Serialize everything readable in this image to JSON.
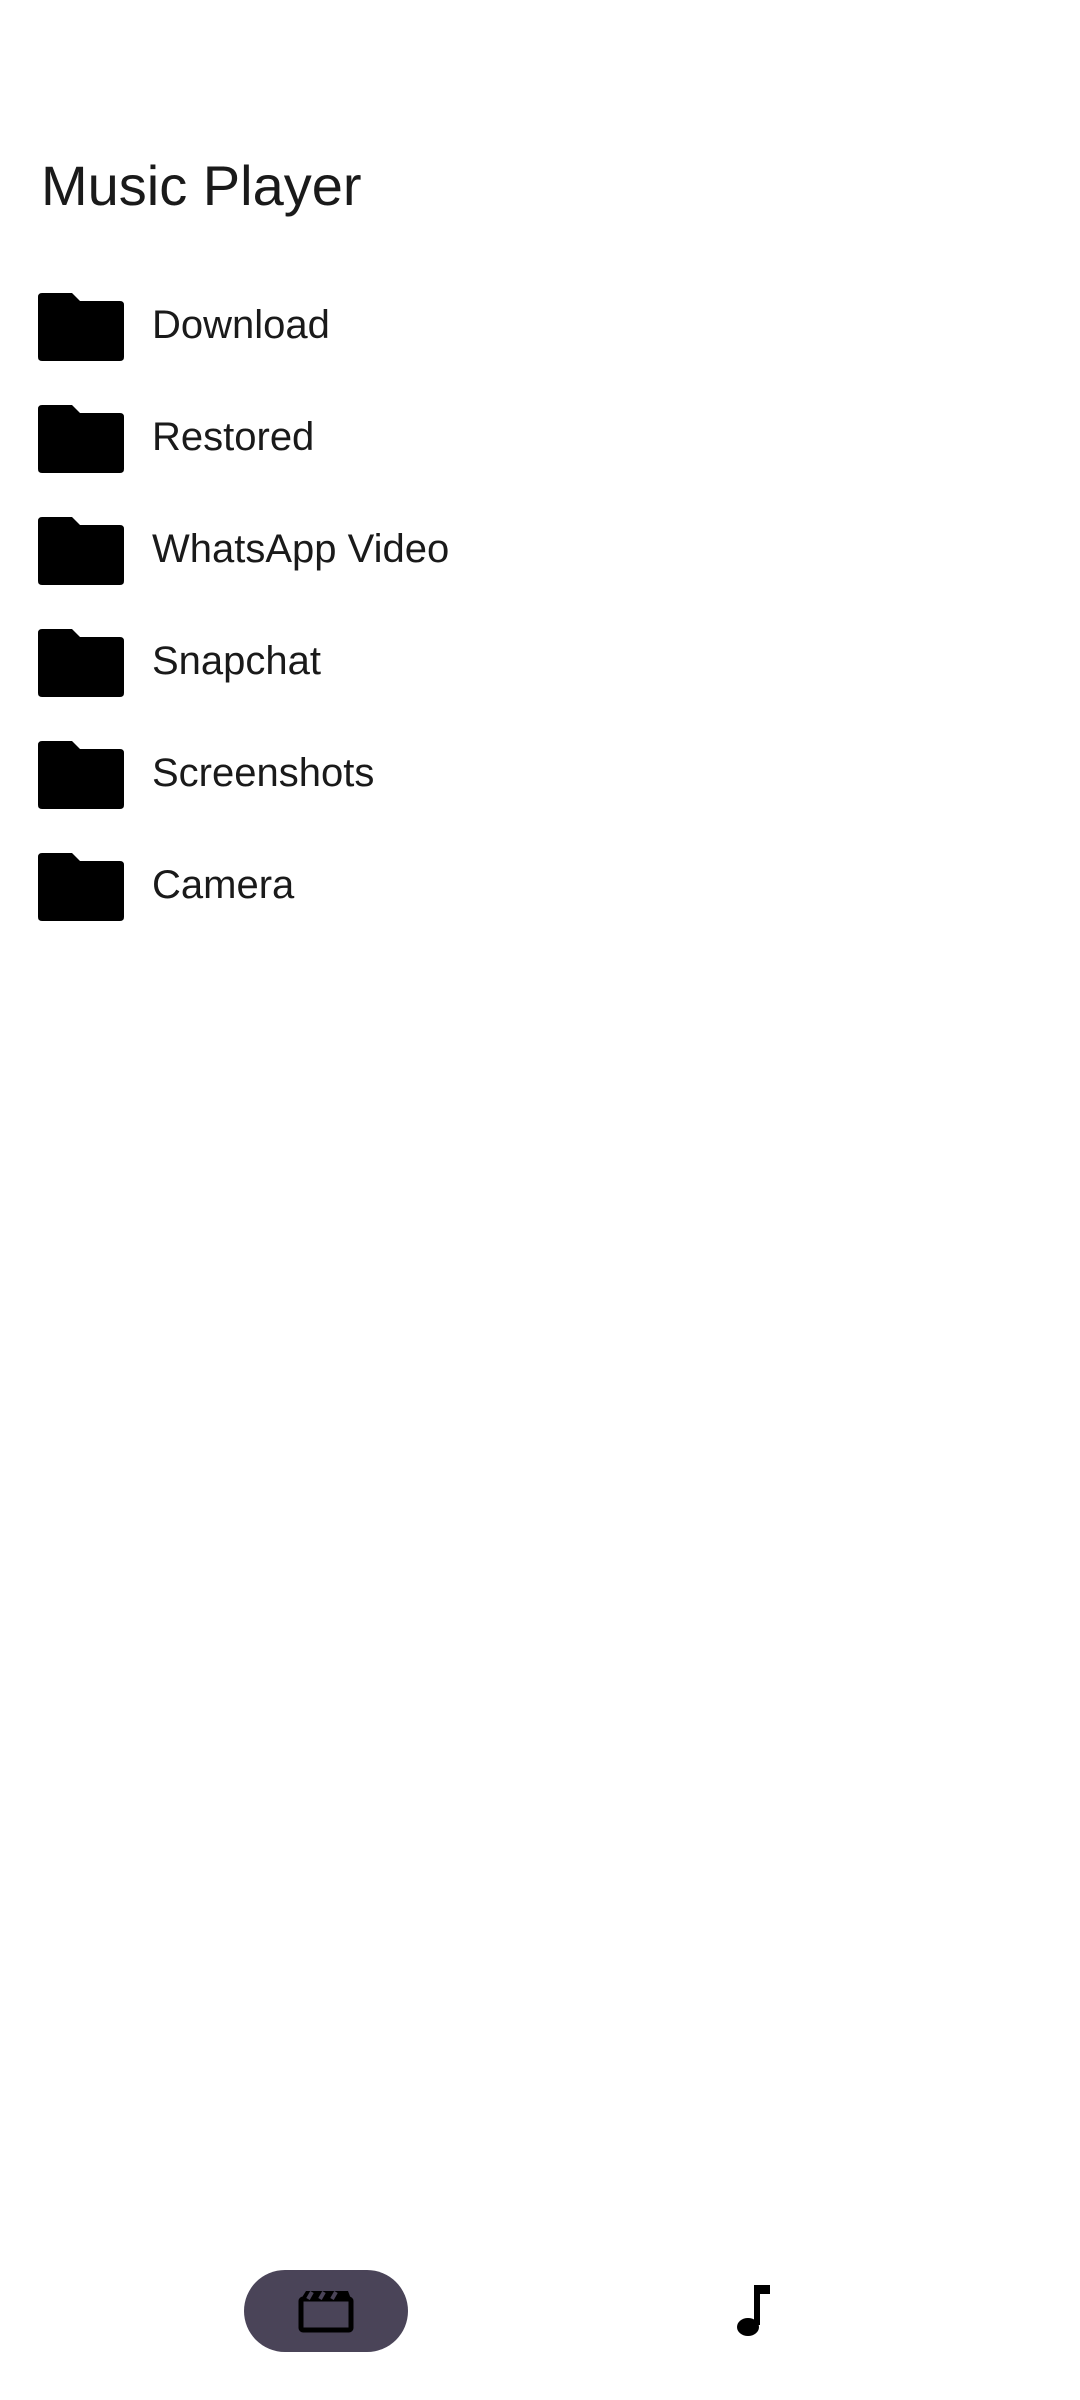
{
  "header": {
    "title": "Music Player"
  },
  "folders": [
    {
      "label": "Download",
      "icon": "folder-icon"
    },
    {
      "label": "Restored",
      "icon": "folder-icon"
    },
    {
      "label": "WhatsApp Video",
      "icon": "folder-icon"
    },
    {
      "label": "Snapchat",
      "icon": "folder-icon"
    },
    {
      "label": "Screenshots",
      "icon": "folder-icon"
    },
    {
      "label": "Camera",
      "icon": "folder-icon"
    }
  ],
  "bottom_nav": {
    "items": [
      {
        "icon": "movie-icon",
        "active": true
      },
      {
        "icon": "music-note-icon",
        "active": false
      }
    ],
    "active_color": "#4a4458"
  }
}
